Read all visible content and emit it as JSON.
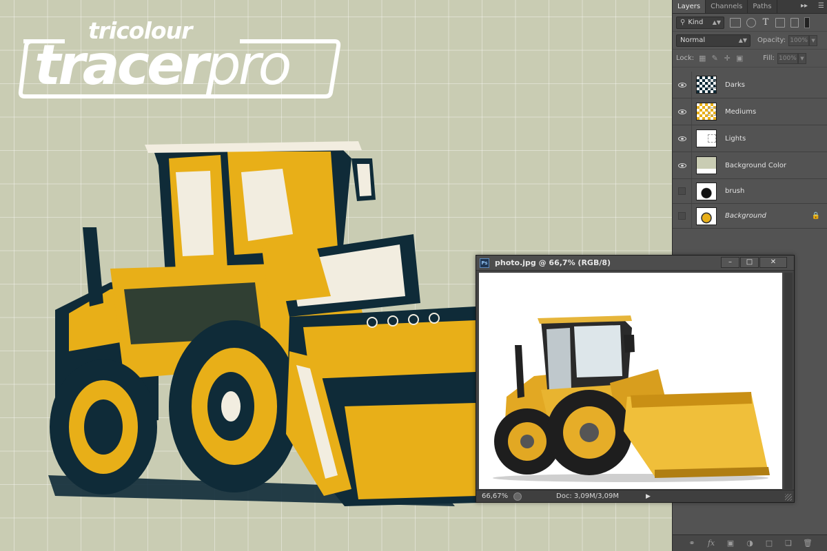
{
  "logo": {
    "top_text": "tricolour",
    "main_bold": "tracer",
    "main_light": "pro"
  },
  "colors": {
    "canvas_bg": "#c9ccb3",
    "ink_dark": "#0f2b38",
    "ink_medium": "#e8af18",
    "ink_light": "#f2ede0",
    "panel_bg": "#535353"
  },
  "layers_panel": {
    "tabs": [
      "Layers",
      "Channels",
      "Paths"
    ],
    "filter_kind": "Kind",
    "blend_mode": "Normal",
    "opacity_label": "Opacity:",
    "opacity_value": "100%",
    "lock_label": "Lock:",
    "fill_label": "Fill:",
    "fill_value": "100%",
    "layers": [
      {
        "name": "Darks",
        "visible": true
      },
      {
        "name": "Mediums",
        "visible": true
      },
      {
        "name": "Lights",
        "visible": true
      },
      {
        "name": "Background Color",
        "visible": true
      },
      {
        "name": "brush",
        "visible": false
      },
      {
        "name": "Background",
        "visible": false,
        "locked": true
      }
    ],
    "footer_icons": [
      "link-icon",
      "fx-icon",
      "mask-icon",
      "adjustment-icon",
      "folder-icon",
      "new-layer-icon",
      "trash-icon"
    ]
  },
  "photo_window": {
    "ps_badge": "Ps",
    "title": "photo.jpg @ 66,7% (RGB/8)",
    "min_label": "–",
    "max_label": "□",
    "close_label": "✕",
    "zoom": "66,67%",
    "doc_info": "Doc: 3,09M/3,09M"
  }
}
